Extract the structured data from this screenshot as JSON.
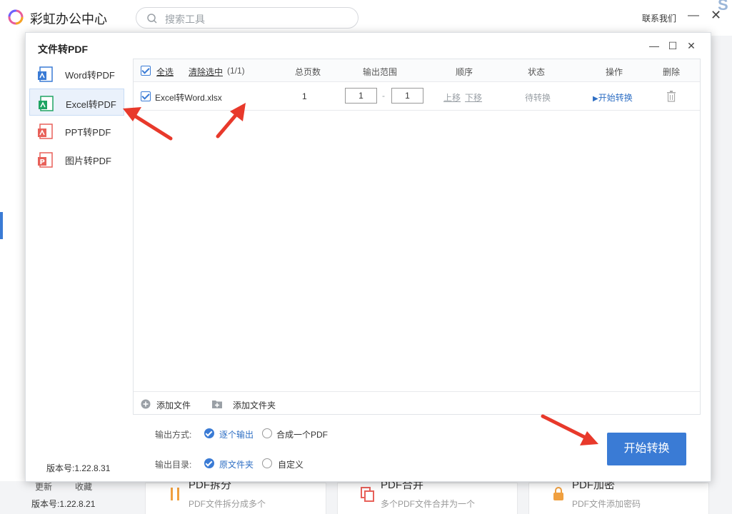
{
  "app": {
    "title": "彩虹办公中心",
    "search_placeholder": "搜索工具",
    "contact": "联系我们",
    "nav_bottom": [
      "更新",
      "收藏"
    ],
    "version": "版本号:1.22.8.21",
    "cards": [
      {
        "title": "PDF拆分",
        "desc": "PDF文件拆分成多个"
      },
      {
        "title": "PDF合并",
        "desc": "多个PDF文件合并为一个"
      },
      {
        "title": "PDF加密",
        "desc": "PDF文件添加密码"
      }
    ],
    "corner_text": "S"
  },
  "dialog": {
    "title": "文件转PDF",
    "version": "版本号:1.22.8.31",
    "nav": [
      {
        "label": "Word转PDF",
        "color": "#3a7bd5"
      },
      {
        "label": "Excel转PDF",
        "color": "#1fa463"
      },
      {
        "label": "PPT转PDF",
        "color": "#e8615a"
      },
      {
        "label": "图片转PDF",
        "color": "#e8615a"
      }
    ],
    "table": {
      "select_all": "全选",
      "clear_selection": "清除选中",
      "count": "(1/1)",
      "headers": {
        "pages": "总页数",
        "range": "输出范围",
        "order": "顺序",
        "status": "状态",
        "action": "操作",
        "delete": "删除"
      },
      "rows": [
        {
          "filename": "Excel转Word.xlsx",
          "pages": "1",
          "range_from": "1",
          "range_sep": "-",
          "range_to": "1",
          "move_up": "上移",
          "move_down": "下移",
          "status": "待转换",
          "action": "开始转换"
        }
      ]
    },
    "add_file": "添加文件",
    "add_folder": "添加文件夹",
    "output_mode_label": "输出方式:",
    "output_mode_options": [
      "逐个输出",
      "合成一个PDF"
    ],
    "output_dir_label": "输出目录:",
    "output_dir_options": [
      "原文件夹",
      "自定义"
    ],
    "start_button": "开始转换"
  },
  "colors": {
    "accent": "#3a7bd5",
    "arrow": "#e8392b"
  }
}
